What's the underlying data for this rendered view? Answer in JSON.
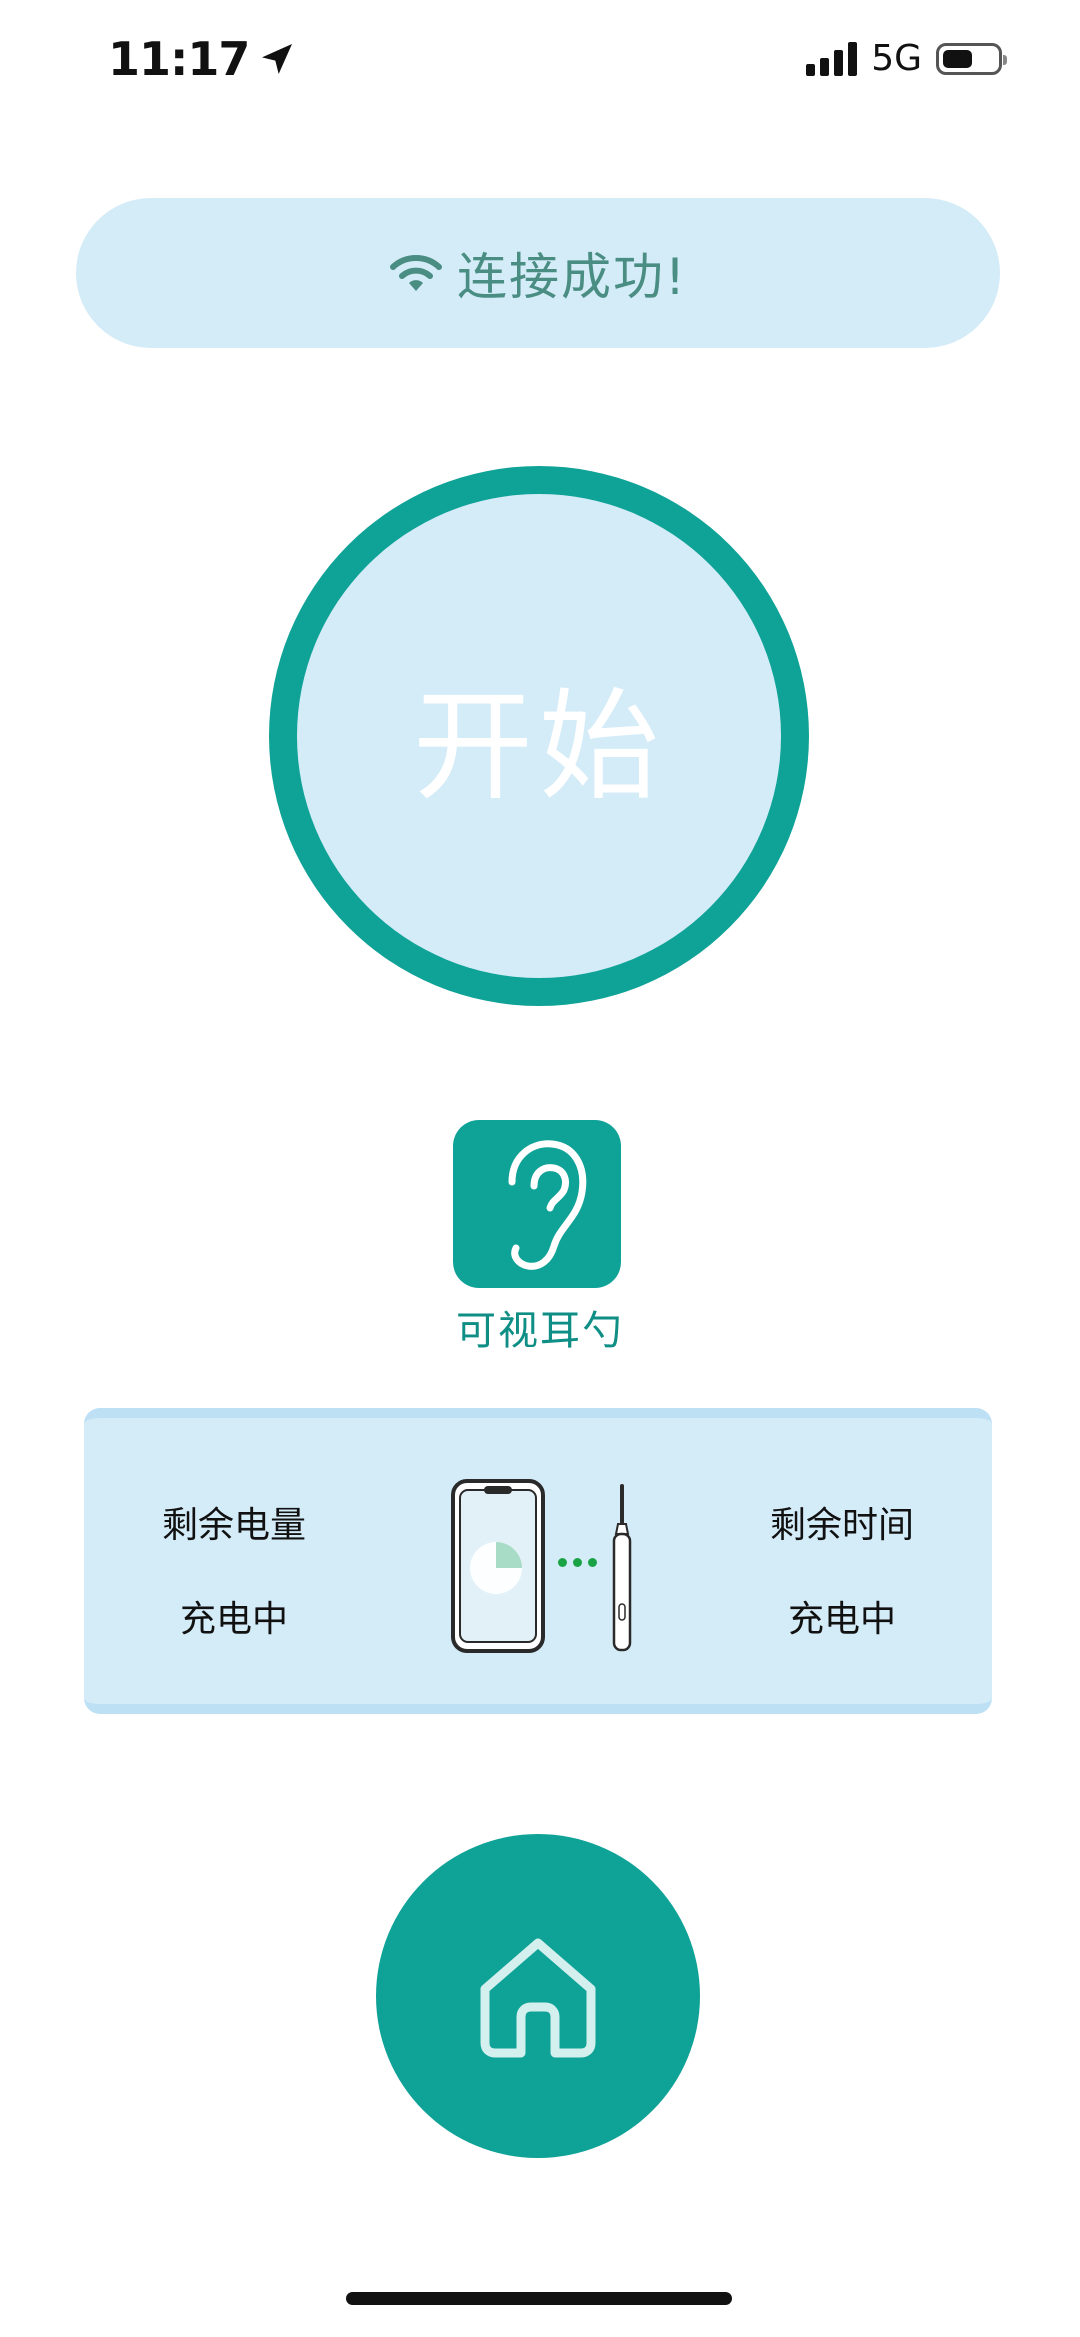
{
  "status_bar": {
    "time": "11:17",
    "network": "5G",
    "battery_level": 0.55,
    "location_icon": "location-arrow-icon",
    "signal_icon": "signal-bars-icon"
  },
  "banner": {
    "text": "连接成功!",
    "icon": "wifi-icon"
  },
  "start_button": {
    "label": "开始"
  },
  "device": {
    "name": "可视耳勺",
    "icon": "ear-icon"
  },
  "info": {
    "battery_title": "剩余电量",
    "battery_value": "充电中",
    "time_title": "剩余时间",
    "time_value": "充电中"
  },
  "nav": {
    "home_icon": "home-icon"
  },
  "colors": {
    "teal": "#0fa297",
    "light_blue": "#d4ecf8",
    "banner_text": "#4a8d83"
  }
}
